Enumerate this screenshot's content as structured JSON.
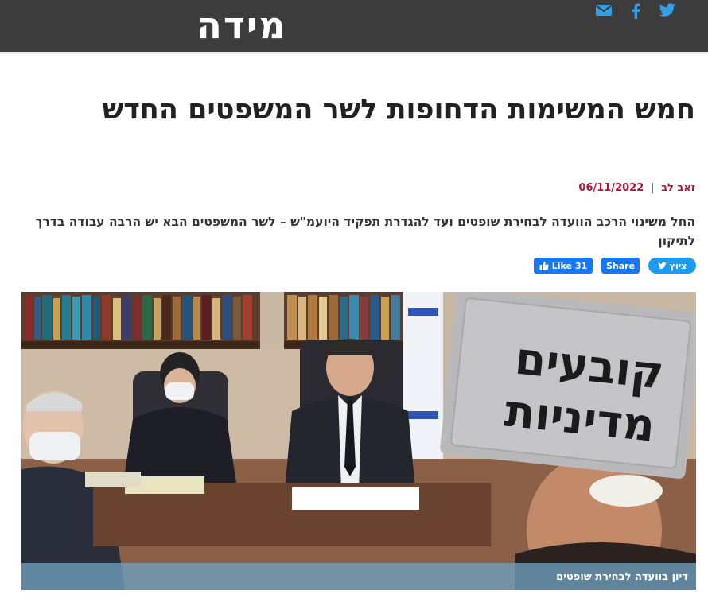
{
  "header": {
    "logo": "מידה",
    "social": [
      {
        "name": "mail",
        "icon": "envelope-icon"
      },
      {
        "name": "facebook",
        "icon": "facebook-icon"
      },
      {
        "name": "twitter",
        "icon": "twitter-icon"
      }
    ],
    "colors": {
      "bar": "#3c3c3c",
      "icons": "#1da1f2"
    }
  },
  "article": {
    "title": "חמש המשימות הדחופות לשר המשפטים החדש",
    "author": "זאב לב",
    "separator": "|",
    "date": "06/11/2022",
    "summary": "החל משינוי הרכב הוועדה לבחירת שופטים ועד להגדרת תפקיד היועמ\"ש – לשר המשפטים הבא יש הרבה עבודה בדרך לתיקון",
    "accent_color": "#b5123a"
  },
  "share": {
    "tweet_label": "ציוץ",
    "share_label": "Share",
    "like_label": "Like",
    "like_count": "31"
  },
  "hero": {
    "stamp_line1": "קובעים",
    "stamp_line2": "מדיניות",
    "caption": "דיון בוועדה לבחירת שופטים"
  }
}
